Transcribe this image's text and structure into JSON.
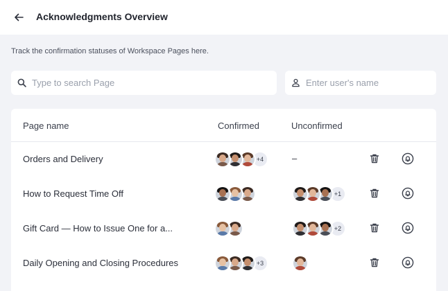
{
  "header": {
    "title": "Acknowledgments Overview",
    "back_icon": "arrow-left-icon"
  },
  "subtitle": "Track the confirmation statuses of Workspace Pages here.",
  "search": {
    "page_placeholder": "Type to search Page",
    "page_value": "",
    "user_placeholder": "Enter user's name",
    "user_value": ""
  },
  "table": {
    "columns": [
      "Page name",
      "Confirmed",
      "Unconfirmed"
    ],
    "rows": [
      {
        "name": "Orders and Delivery",
        "confirmed": {
          "avatars": 3,
          "more": "+4"
        },
        "unconfirmed": {
          "avatars": 0,
          "more": "",
          "empty": "–"
        }
      },
      {
        "name": "How to Request Time Off",
        "confirmed": {
          "avatars": 3,
          "more": ""
        },
        "unconfirmed": {
          "avatars": 3,
          "more": "+1",
          "empty": ""
        }
      },
      {
        "name": "Gift Card — How to Issue One for a...",
        "confirmed": {
          "avatars": 2,
          "more": ""
        },
        "unconfirmed": {
          "avatars": 3,
          "more": "+2",
          "empty": ""
        }
      },
      {
        "name": "Daily Opening and Closing Procedures",
        "confirmed": {
          "avatars": 3,
          "more": "+3"
        },
        "unconfirmed": {
          "avatars": 1,
          "more": "",
          "empty": ""
        }
      }
    ]
  },
  "icons": {
    "delete": "trash-icon",
    "remind": "bell-icon",
    "search": "search-icon",
    "user": "user-icon"
  }
}
